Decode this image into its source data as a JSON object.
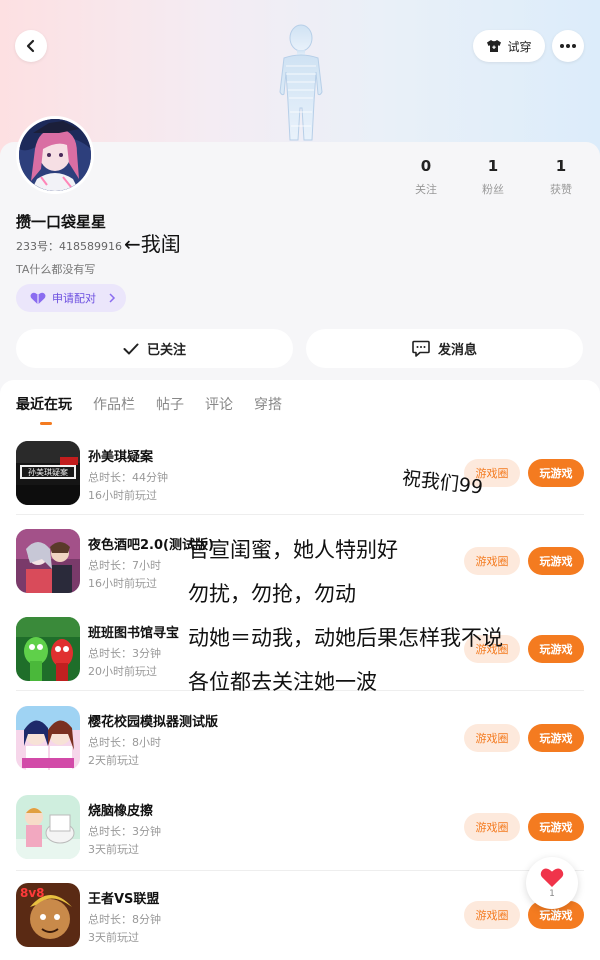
{
  "header": {
    "tryon_label": "试穿"
  },
  "profile": {
    "username": "攒一口袋星星",
    "uid": "233号：418589916",
    "bio": "TA什么都没有写",
    "pair_label": "申请配对",
    "stats": [
      {
        "num": "0",
        "label": "关注"
      },
      {
        "num": "1",
        "label": "粉丝"
      },
      {
        "num": "1",
        "label": "获赞"
      }
    ],
    "followed_label": "已关注",
    "message_label": "发消息"
  },
  "tabs": [
    "最近在玩",
    "作品栏",
    "帖子",
    "评论",
    "穿搭"
  ],
  "games": [
    {
      "name": "孙美琪疑案",
      "duration": "总时长：44分钟",
      "last_played": "16小时前玩过",
      "icon": "sun-meiqi-game-icon"
    },
    {
      "name": "夜色酒吧2.0(测试版)",
      "duration": "总时长：7小时",
      "last_played": "16小时前玩过",
      "icon": "night-bar-game-icon"
    },
    {
      "name": "班班图书馆寻宝",
      "duration": "总时长：3分钟",
      "last_played": "20小时前玩过",
      "icon": "banban-game-icon"
    },
    {
      "name": "樱花校园模拟器测试版",
      "duration": "总时长：8小时",
      "last_played": "2天前玩过",
      "icon": "sakura-school-game-icon"
    },
    {
      "name": "烧脑橡皮擦",
      "duration": "总时长：3分钟",
      "last_played": "3天前玩过",
      "icon": "brain-eraser-game-icon"
    },
    {
      "name": "王者VS联盟",
      "duration": "总时长：8分钟",
      "last_played": "3天前玩过",
      "icon": "king-vs-league-game-icon"
    }
  ],
  "row_buttons": {
    "circle": "游戏圈",
    "play": "玩游戏"
  },
  "annotations": {
    "arrow_note": "←我闺",
    "wish": "祝我们99",
    "lines": [
      "官宣闺蜜，她人特别好",
      "勿扰，勿抢，勿动",
      "动她＝动我，动她后果怎样我不说",
      "各位都去关注她一波"
    ]
  },
  "fav": {
    "count": "1"
  },
  "colors": {
    "accent": "#f47b20",
    "accent_light": "#fde9dc",
    "pair_purple": "#6c4fe0",
    "heart_red": "#f0344a"
  }
}
